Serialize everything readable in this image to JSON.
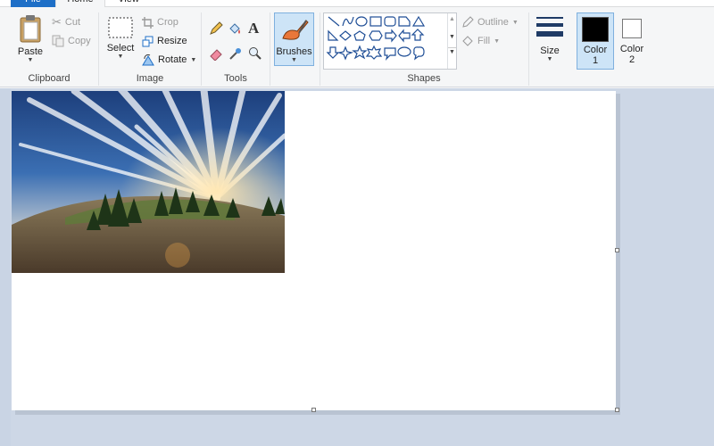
{
  "tabs": {
    "file": "File",
    "home": "Home",
    "view": "View"
  },
  "clipboard": {
    "paste": "Paste",
    "cut": "Cut",
    "copy": "Copy",
    "label": "Clipboard"
  },
  "image": {
    "select": "Select",
    "crop": "Crop",
    "resize": "Resize",
    "rotate": "Rotate",
    "label": "Image"
  },
  "tools": {
    "label": "Tools"
  },
  "brushes": {
    "label": "Brushes"
  },
  "shapes": {
    "outline": "Outline",
    "fill": "Fill",
    "label": "Shapes"
  },
  "size": {
    "label": "Size"
  },
  "colors": {
    "color1_line1": "Color",
    "color1_line2": "1",
    "color2_line1": "Color",
    "color2_line2": "2",
    "color1": "#000000",
    "color2": "#ffffff"
  },
  "accent": "#1e6fc7"
}
